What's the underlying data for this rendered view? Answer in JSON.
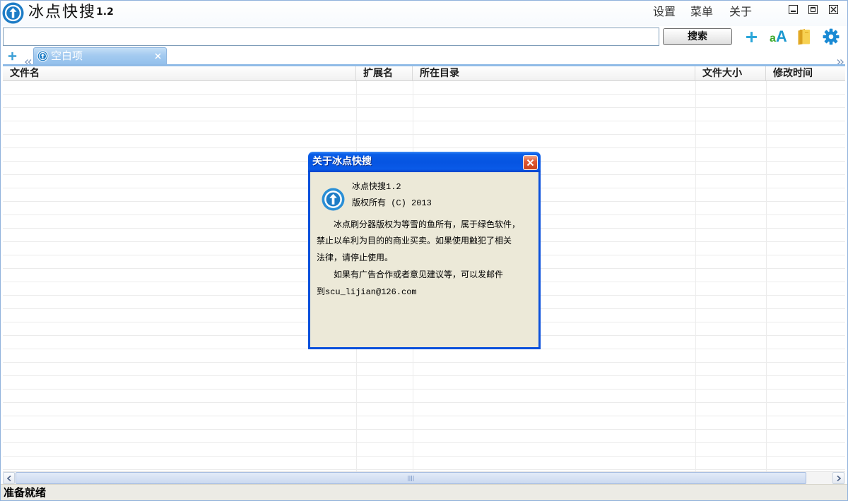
{
  "window": {
    "title": "冰点快搜",
    "version": "1.2",
    "menu": {
      "settings": "设置",
      "menu": "菜单",
      "about": "关于"
    }
  },
  "search": {
    "value": "",
    "placeholder": "",
    "button_label": "搜索"
  },
  "toolbar": {
    "font_icon": {
      "small": "a",
      "large": "A"
    }
  },
  "tabs": {
    "items": [
      {
        "label": "空白项"
      }
    ]
  },
  "table": {
    "columns": [
      "文件名",
      "扩展名",
      "所在目录",
      "文件大小",
      "修改时间"
    ],
    "rows": []
  },
  "status_bar": {
    "text": "准备就绪"
  },
  "about_dialog": {
    "title": "关于冰点快搜",
    "heading": "冰点快搜1.2",
    "copyright": "版权所有 (C) 2013",
    "paragraphs": [
      [
        "冰点刷分器版权为等雪的鱼所有，属于绿色软件，",
        "禁止以牟利为目的的商业买卖。如果使用触犯了相关",
        "法律，请停止使用。"
      ],
      [
        "如果有广告合作或者意见建议等，可以发邮件",
        "到scu_lijian@126.com"
      ]
    ]
  },
  "icons": {
    "app": "app-logo-icon",
    "minimize": "minimize-icon",
    "maximize": "maximize-icon",
    "close": "close-icon",
    "add": "plus-icon",
    "font": "font-size-icon",
    "folder": "folder-icon",
    "settings": "gear-icon",
    "tab_scroll_left": "double-chevron-left-icon",
    "tab_scroll_right": "double-chevron-right-icon",
    "tab_close": "tab-close-icon",
    "scroll_left": "chevron-left-icon",
    "scroll_right": "chevron-right-icon"
  },
  "colors": {
    "accent": "#1d7cc6",
    "tab_active": "#a4cbf0",
    "dialog_titlebar": "#0654e1",
    "dialog_body": "#ece9d8",
    "dialog_close": "#e05a34",
    "toolbar_plus": "#2aa6d9",
    "toolbar_gear": "#1a8ad4",
    "font_icon_small": "#3faa2e",
    "font_icon_large": "#1b98cf"
  }
}
